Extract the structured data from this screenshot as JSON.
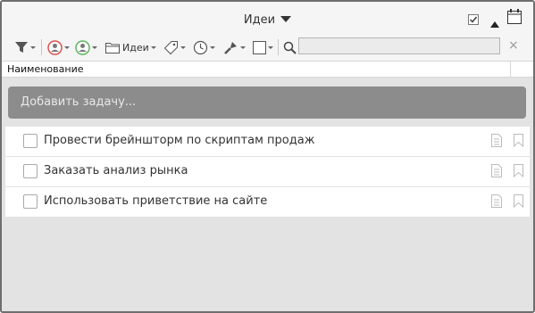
{
  "window": {
    "title": "Идеи"
  },
  "icons": {
    "title_dropdown": "triangle-down-icon",
    "checkbox_mode": "checkbox-checked-icon",
    "collapse": "triangle-up-icon",
    "calendar": "calendar-icon"
  },
  "toolbar": {
    "items": [
      {
        "id": "filter",
        "icon": "filter-icon"
      },
      {
        "id": "assignee",
        "icon": "user-red-icon"
      },
      {
        "id": "owner",
        "icon": "user-green-icon"
      },
      {
        "id": "folder",
        "icon": "folder-icon",
        "label": "Идеи"
      },
      {
        "id": "tag",
        "icon": "tag-icon"
      },
      {
        "id": "time",
        "icon": "clock-icon"
      },
      {
        "id": "tools",
        "icon": "brush-icon"
      },
      {
        "id": "status",
        "icon": "square-icon"
      },
      {
        "id": "search",
        "icon": "search-icon"
      }
    ],
    "search_value": "",
    "clear_icon": "×"
  },
  "column_header": {
    "name": "Наименование"
  },
  "add_task": {
    "placeholder": "Добавить задачу..."
  },
  "tasks": [
    {
      "title": "Провести брейншторм по скриптам продаж",
      "done": false
    },
    {
      "title": "Заказать анализ рынка",
      "done": false
    },
    {
      "title": "Использовать приветствие на сайте",
      "done": false
    }
  ],
  "colors": {
    "frame": "#6e6e6e",
    "toolbar_bg": "#f5f5f5",
    "add_bar_bg": "#8c8c8c",
    "content_bg": "#e3e3e3",
    "user_red": "#d9534f",
    "user_green": "#5cb85c"
  }
}
